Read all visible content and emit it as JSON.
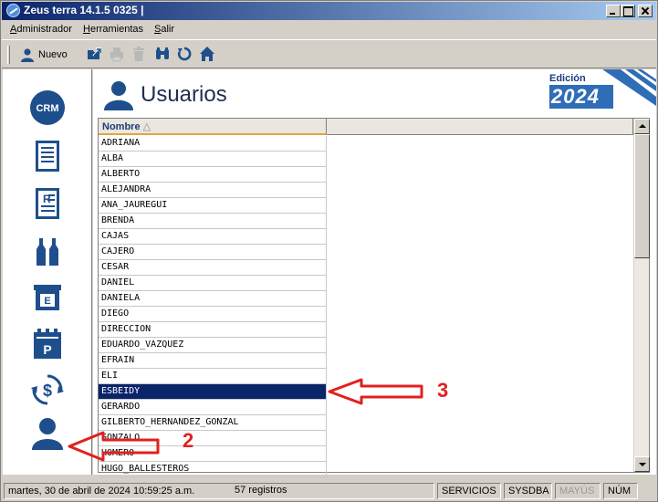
{
  "window": {
    "title": "Zeus terra 14.1.5 0325 |"
  },
  "menu": [
    {
      "label": "Administrador",
      "underline": "A",
      "rest": "dministrador"
    },
    {
      "label": "Herramientas",
      "underline": "H",
      "rest": "erramientas"
    },
    {
      "label": "Salir",
      "underline": "S",
      "rest": "alir"
    }
  ],
  "toolbar": {
    "new_label": "Nuevo",
    "buttons": [
      "export-icon",
      "print-icon",
      "delete-icon",
      "binoculars-icon",
      "refresh-icon",
      "home-icon"
    ]
  },
  "sidebar": {
    "items": [
      "crm-icon",
      "document-list-icon",
      "report-icon",
      "bottles-icon",
      "archive-box-icon",
      "calendar-p-icon",
      "currency-exchange-icon",
      "user-icon"
    ],
    "crm_label": "CRM",
    "archive_label": "E",
    "calendar_label": "P"
  },
  "page": {
    "title": "Usuarios"
  },
  "edition": {
    "label": "Edición",
    "year": "2024"
  },
  "grid": {
    "column": "Nombre",
    "sort_indicator": "△",
    "rows": [
      "ADRIANA",
      "ALBA",
      "ALBERTO",
      "ALEJANDRA",
      "ANA_JAUREGUI",
      "BRENDA",
      "CAJAS",
      "CAJERO",
      "CESAR",
      "DANIEL",
      "DANIELA",
      "DIEGO",
      "DIRECCION",
      "EDUARDO_VAZQUEZ",
      "EFRAIN",
      "ELI",
      "ESBEIDY",
      "GERARDO",
      "GILBERTO_HERNANDEZ_GONZAL",
      "GONZALO",
      "HOMERO",
      "HUGO_BALLESTEROS"
    ],
    "selected_row": "ESBEIDY"
  },
  "annotations": {
    "step_2": "2",
    "step_3": "3"
  },
  "status": {
    "datetime": "martes, 30 de abril de 2024 10:59:25 a.m.",
    "records": "57 registros",
    "servicios": "SERVICIOS",
    "user": "SYSDBA",
    "caps": "MAYÚS",
    "num": "NÚM"
  },
  "colors": {
    "accent": "#0a246a",
    "icon_blue": "#1e4f8c",
    "arrow_red": "#e02020"
  }
}
